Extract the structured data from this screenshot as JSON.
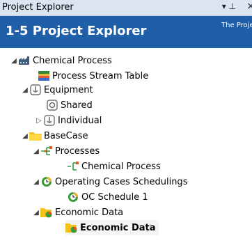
{
  "window": {
    "title": "Project Explorer",
    "pin_menu": "▾ ⊥",
    "close": "×"
  },
  "header": {
    "title": "1-5 Project Explorer",
    "description": "The Project"
  },
  "tree": [
    {
      "label": "Chemical Process",
      "icon": "factory-icon",
      "expander": "◢"
    },
    {
      "label": "Process Stream Table",
      "icon": "table-icon",
      "expander": ""
    },
    {
      "label": "Equipment",
      "icon": "equipment-icon",
      "expander": "◢"
    },
    {
      "label": "Shared",
      "icon": "shared-icon",
      "expander": ""
    },
    {
      "label": "Individual",
      "icon": "equipment-icon",
      "expander": "▷"
    },
    {
      "label": "BaseCase",
      "icon": "folder-icon",
      "expander": "◢"
    },
    {
      "label": "Processes",
      "icon": "process-icon",
      "expander": "◢"
    },
    {
      "label": "Chemical Process",
      "icon": "process-icon",
      "expander": ""
    },
    {
      "label": "Operating Cases Schedulings",
      "icon": "schedule-icon",
      "expander": "◢"
    },
    {
      "label": "OC Schedule 1",
      "icon": "schedule-icon",
      "expander": ""
    },
    {
      "label": "Economic Data",
      "icon": "folder-chart-icon",
      "expander": "◢"
    },
    {
      "label": "Economic Data",
      "icon": "folder-chart-icon",
      "expander": ""
    }
  ],
  "colors": {
    "header_bg": "#1f5fa8",
    "titlebar_bg": "#dbe5f1"
  }
}
